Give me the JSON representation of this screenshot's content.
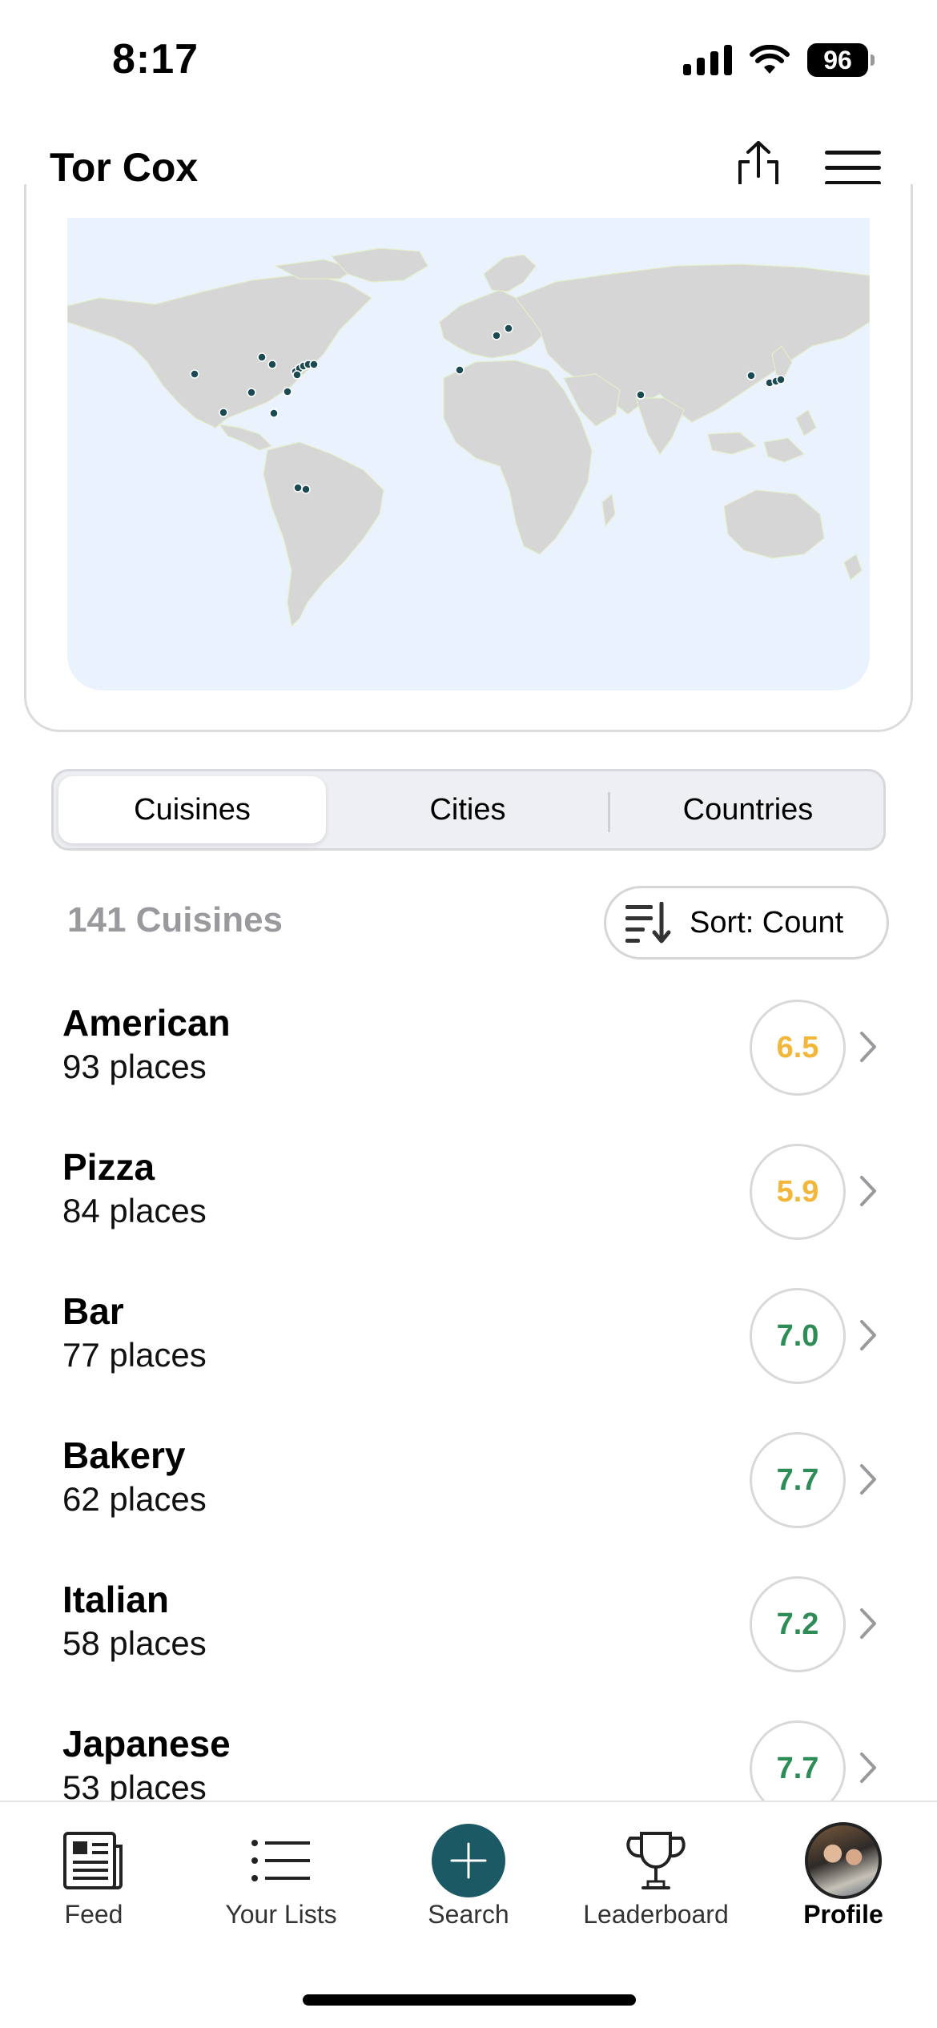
{
  "status_bar": {
    "time": "8:17",
    "battery": "96"
  },
  "header": {
    "title": "Tor Cox"
  },
  "segmented": {
    "tabs": [
      "Cuisines",
      "Cities",
      "Countries"
    ],
    "active": "Cuisines"
  },
  "list_header": {
    "count_label": "141 Cuisines",
    "sort_label": "Sort: Count"
  },
  "cuisines": [
    {
      "name": "American",
      "places": "93 places",
      "score": "6.5",
      "score_color": "#f2b73a"
    },
    {
      "name": "Pizza",
      "places": "84 places",
      "score": "5.9",
      "score_color": "#f2b73a"
    },
    {
      "name": "Bar",
      "places": "77 places",
      "score": "7.0",
      "score_color": "#2e8c57"
    },
    {
      "name": "Bakery",
      "places": "62 places",
      "score": "7.7",
      "score_color": "#2e8c57"
    },
    {
      "name": "Italian",
      "places": "58 places",
      "score": "7.2",
      "score_color": "#2e8c57"
    },
    {
      "name": "Japanese",
      "places": "53 places",
      "score": "7.7",
      "score_color": "#2e8c57"
    }
  ],
  "tabbar": {
    "tabs": [
      {
        "label": "Feed",
        "icon": "newspaper-icon"
      },
      {
        "label": "Your Lists",
        "icon": "list-icon"
      },
      {
        "label": "Search",
        "icon": "plus-icon"
      },
      {
        "label": "Leaderboard",
        "icon": "trophy-icon"
      },
      {
        "label": "Profile",
        "icon": "avatar"
      }
    ],
    "active": "Profile"
  },
  "colors": {
    "accent": "#1b5965",
    "map_water": "#e9f2fd",
    "map_land": "#d6d6d6",
    "pin": "#1b4a52"
  }
}
